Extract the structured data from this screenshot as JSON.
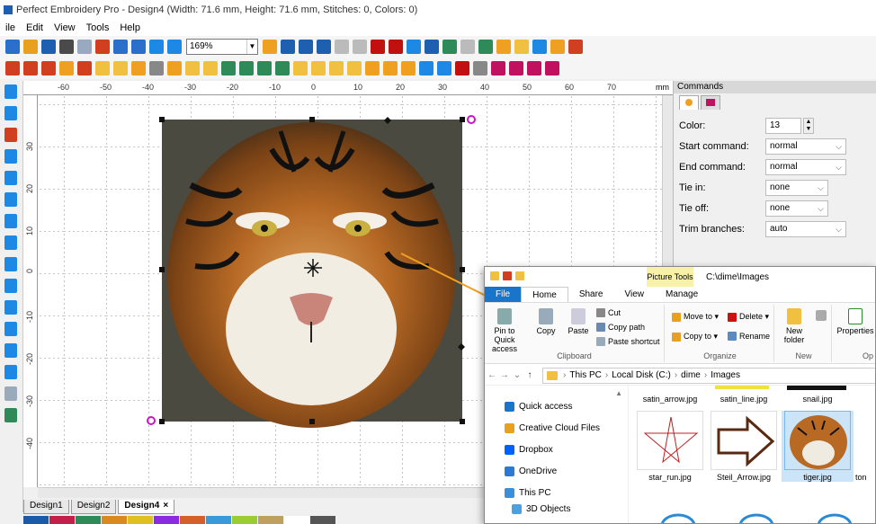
{
  "app": {
    "title": "Perfect Embroidery Pro - Design4 (Width: 71.6 mm, Height: 71.6 mm, Stitches: 0, Colors: 0)"
  },
  "menu": [
    "ile",
    "Edit",
    "View",
    "Tools",
    "Help"
  ],
  "toolbar": {
    "zoom_value": "169%"
  },
  "ruler": {
    "units": "mm",
    "h_ticks": [
      "-60",
      "-50",
      "-40",
      "-30",
      "-20",
      "-10",
      "0",
      "10",
      "20",
      "30",
      "40",
      "50",
      "60",
      "70"
    ],
    "v_ticks": [
      "30",
      "20",
      "10",
      "0",
      "-10",
      "-20",
      "-30",
      "-40"
    ]
  },
  "tabs": [
    {
      "label": "Design1"
    },
    {
      "label": "Design2"
    },
    {
      "label": "Design4",
      "close": "×"
    }
  ],
  "palette": {
    "colors": [
      "#1a5aa8",
      "#c21f4a",
      "#2e8b57",
      "#d98a1e",
      "#e0c020",
      "#8a2be2",
      "#d45f2a",
      "#3a9ad9",
      "#9acd32",
      "#c0a060",
      "#ffffff",
      "#555555"
    ]
  },
  "commands": {
    "header": "Commands",
    "color_label": "Color:",
    "color_value": "13",
    "start_label": "Start command:",
    "start_value": "normal",
    "end_label": "End command:",
    "end_value": "normal",
    "tiein_label": "Tie in:",
    "tiein_value": "none",
    "tieoff_label": "Tie off:",
    "tieoff_value": "none",
    "trim_label": "Trim branches:",
    "trim_value": "auto"
  },
  "explorer": {
    "picture_tools": "Picture Tools",
    "path_title": "C:\\dime\\Images",
    "ribbon_tabs": [
      "File",
      "Home",
      "Share",
      "View",
      "Manage"
    ],
    "clipboard": {
      "pin": "Pin to Quick access",
      "copy": "Copy",
      "paste": "Paste",
      "cut": "Cut",
      "copy_path": "Copy path",
      "paste_shortcut": "Paste shortcut",
      "label": "Clipboard"
    },
    "organize": {
      "move_to": "Move to ▾",
      "copy_to": "Copy to ▾",
      "delete": "Delete ▾",
      "rename": "Rename",
      "label": "Organize"
    },
    "new": {
      "new_folder": "New folder",
      "label": "New"
    },
    "open": {
      "properties": "Properties",
      "label": "Op"
    },
    "breadcrumb": [
      "This PC",
      "Local Disk (C:)",
      "dime",
      "Images"
    ],
    "nav_items": [
      {
        "label": "Quick access",
        "color": "#1a74c9"
      },
      {
        "label": "Creative Cloud Files",
        "color": "#e8a020"
      },
      {
        "label": "Dropbox",
        "color": "#0061fe"
      },
      {
        "label": "OneDrive",
        "color": "#2a7ad5"
      },
      {
        "label": "This PC",
        "color": "#3a8fd8"
      },
      {
        "label": "3D Objects",
        "color": "#4aa0e0"
      }
    ],
    "files_row1": [
      "satin_arrow.jpg",
      "satin_line.jpg",
      "snail.jpg"
    ],
    "files_row2": [
      "star_run.jpg",
      "Steil_Arrow.jpg",
      "tiger.jpg",
      "ton"
    ]
  }
}
